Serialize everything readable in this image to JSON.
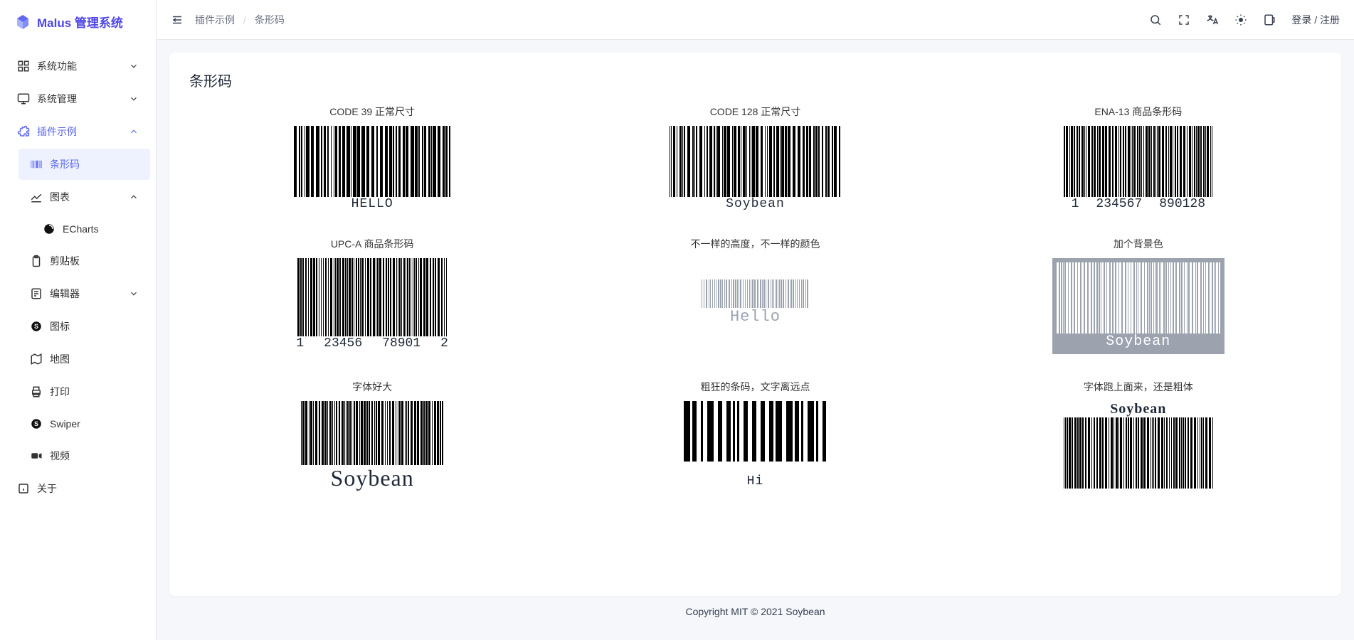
{
  "brand": {
    "name": "Malus 管理系统"
  },
  "nav": {
    "system_func": "系统功能",
    "system_mgmt": "系统管理",
    "plugin_demo": "插件示例",
    "barcode": "条形码",
    "chart": "图表",
    "echarts": "ECharts",
    "clipboard": "剪贴板",
    "editor": "编辑器",
    "icon": "图标",
    "map": "地图",
    "print": "打印",
    "swiper": "Swiper",
    "video": "视频",
    "about": "关于"
  },
  "breadcrumb": {
    "parent": "插件示例",
    "current": "条形码"
  },
  "topbar": {
    "login": "登录 / 注册"
  },
  "page": {
    "title": "条形码"
  },
  "cells": {
    "c1": {
      "title": "CODE 39 正常尺寸",
      "text": "HELLO"
    },
    "c2": {
      "title": "CODE 128 正常尺寸",
      "text": "Soybean"
    },
    "c3": {
      "title": "ENA-13 商品条形码",
      "lead": "1",
      "mid": "234567",
      "tail": "890128"
    },
    "c4": {
      "title": "UPC-A 商品条形码",
      "lead": "1",
      "mid1": "23456",
      "mid2": "78901",
      "tail": "2"
    },
    "c5": {
      "title": "不一样的高度，不一样的颜色",
      "text": "Hello"
    },
    "c6": {
      "title": "加个背景色",
      "text": "Soybean"
    },
    "c7": {
      "title": "字体好大",
      "text": "Soybean"
    },
    "c8": {
      "title": "粗狂的条码，文字离远点",
      "text": "Hi"
    },
    "c9": {
      "title": "字体跑上面来，还是粗体",
      "text": "Soybean"
    }
  },
  "footer": {
    "text": "Copyright MIT © 2021 Soybean"
  }
}
